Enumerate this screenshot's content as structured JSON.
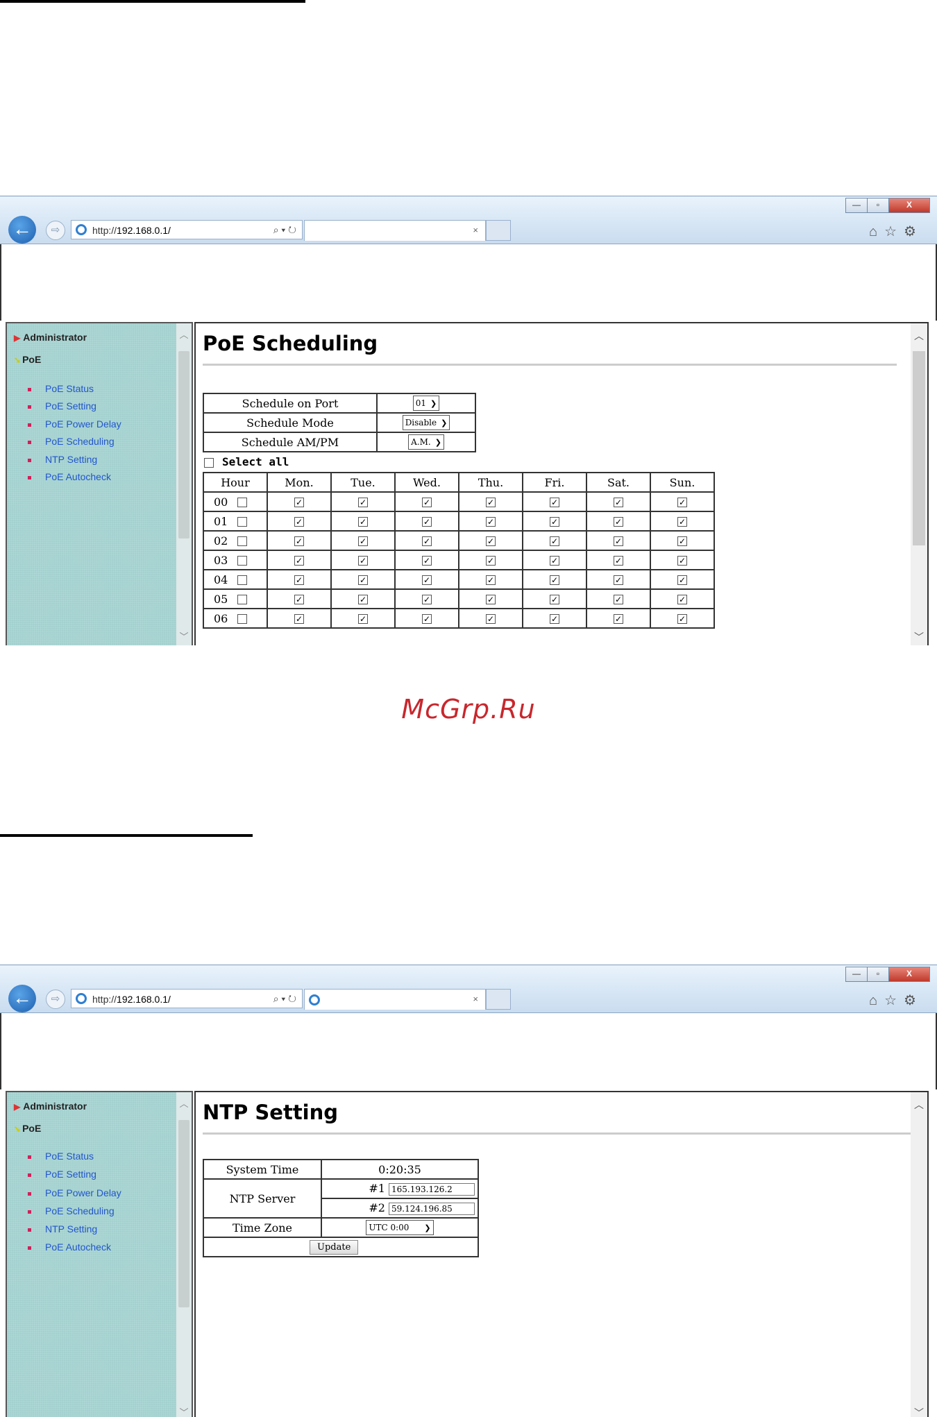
{
  "watermark": "McGrp.Ru",
  "browser": {
    "url_prefix": "http://",
    "url_host": "192.168.0.1/",
    "addr_tools": "⌕ ▾ ↻",
    "tab_close": "×",
    "window_controls": {
      "minimize": "—",
      "maximize": "▫",
      "close": "X"
    },
    "tool_icons": "⌂☆⚙"
  },
  "sidebar": {
    "admin_label": "Administrator",
    "poe_label": "PoE",
    "items": [
      {
        "label": "PoE Status"
      },
      {
        "label": "PoE Setting"
      },
      {
        "label": "PoE Power Delay"
      },
      {
        "label": "PoE Scheduling"
      },
      {
        "label": "NTP Setting"
      },
      {
        "label": "PoE Autocheck"
      }
    ]
  },
  "scheduling": {
    "title": "PoE Scheduling",
    "port_label": "Schedule on Port",
    "port_value": "01",
    "mode_label": "Schedule Mode",
    "mode_value": "Disable",
    "ampm_label": "Schedule AM/PM",
    "ampm_value": "A.M.",
    "select_all": "Select all",
    "columns": [
      "Hour",
      "Mon.",
      "Tue.",
      "Wed.",
      "Thu.",
      "Fri.",
      "Sat.",
      "Sun."
    ],
    "rows": [
      {
        "hour": "00",
        "hour_checked": false,
        "days": [
          true,
          true,
          true,
          true,
          true,
          true,
          true
        ]
      },
      {
        "hour": "01",
        "hour_checked": false,
        "days": [
          true,
          true,
          true,
          true,
          true,
          true,
          true
        ]
      },
      {
        "hour": "02",
        "hour_checked": false,
        "days": [
          true,
          true,
          true,
          true,
          true,
          true,
          true
        ]
      },
      {
        "hour": "03",
        "hour_checked": false,
        "days": [
          true,
          true,
          true,
          true,
          true,
          true,
          true
        ]
      },
      {
        "hour": "04",
        "hour_checked": false,
        "days": [
          true,
          true,
          true,
          true,
          true,
          true,
          true
        ]
      },
      {
        "hour": "05",
        "hour_checked": false,
        "days": [
          true,
          true,
          true,
          true,
          true,
          true,
          true
        ]
      },
      {
        "hour": "06",
        "hour_checked": false,
        "days": [
          true,
          true,
          true,
          true,
          true,
          true,
          true
        ]
      }
    ]
  },
  "ntp": {
    "title": "NTP Setting",
    "system_time_label": "System Time",
    "system_time_value": "0:20:35",
    "ntp_server_label": "NTP Server",
    "server1_label": "#1",
    "server1_value": "165.193.126.2",
    "server2_label": "#2",
    "server2_value": "59.124.196.85",
    "time_zone_label": "Time Zone",
    "time_zone_value": "UTC 0:00",
    "update_label": "Update"
  }
}
